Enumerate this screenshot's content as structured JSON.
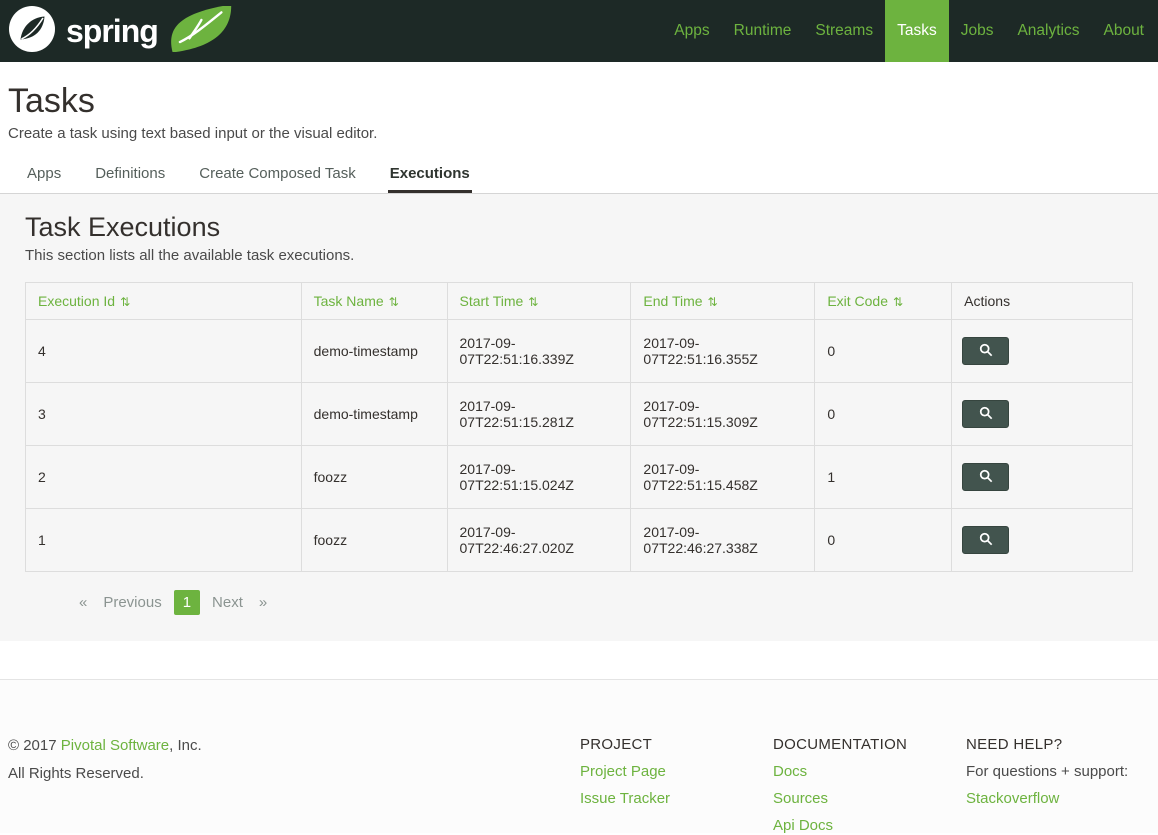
{
  "navbar": {
    "brand": "spring",
    "items": [
      {
        "label": "Apps",
        "active": false
      },
      {
        "label": "Runtime",
        "active": false
      },
      {
        "label": "Streams",
        "active": false
      },
      {
        "label": "Tasks",
        "active": true
      },
      {
        "label": "Jobs",
        "active": false
      },
      {
        "label": "Analytics",
        "active": false
      },
      {
        "label": "About",
        "active": false
      }
    ]
  },
  "page": {
    "title": "Tasks",
    "subtitle": "Create a task using text based input or the visual editor."
  },
  "tabs": [
    {
      "label": "Apps",
      "active": false
    },
    {
      "label": "Definitions",
      "active": false
    },
    {
      "label": "Create Composed Task",
      "active": false
    },
    {
      "label": "Executions",
      "active": true
    }
  ],
  "section": {
    "title": "Task Executions",
    "subtitle": "This section lists all the available task executions."
  },
  "table": {
    "columns": [
      {
        "label": "Execution Id",
        "sortable": true
      },
      {
        "label": "Task Name",
        "sortable": true
      },
      {
        "label": "Start Time",
        "sortable": true
      },
      {
        "label": "End Time",
        "sortable": true
      },
      {
        "label": "Exit Code",
        "sortable": true
      },
      {
        "label": "Actions",
        "sortable": false
      }
    ],
    "rows": [
      {
        "execution_id": "4",
        "task_name": "demo-timestamp",
        "start_time": "2017-09-07T22:51:16.339Z",
        "end_time": "2017-09-07T22:51:16.355Z",
        "exit_code": "0"
      },
      {
        "execution_id": "3",
        "task_name": "demo-timestamp",
        "start_time": "2017-09-07T22:51:15.281Z",
        "end_time": "2017-09-07T22:51:15.309Z",
        "exit_code": "0"
      },
      {
        "execution_id": "2",
        "task_name": "foozz",
        "start_time": "2017-09-07T22:51:15.024Z",
        "end_time": "2017-09-07T22:51:15.458Z",
        "exit_code": "1"
      },
      {
        "execution_id": "1",
        "task_name": "foozz",
        "start_time": "2017-09-07T22:46:27.020Z",
        "end_time": "2017-09-07T22:46:27.338Z",
        "exit_code": "0"
      }
    ]
  },
  "pagination": {
    "first_symbol": "«",
    "prev_label": "Previous",
    "current_page": "1",
    "next_label": "Next",
    "last_symbol": "»"
  },
  "footer": {
    "copyright_prefix": "© 2017",
    "company_link": "Pivotal Software",
    "copyright_suffix": ", Inc.",
    "rights": "All Rights Reserved.",
    "columns": [
      {
        "title": "PROJECT",
        "links": [
          "Project Page",
          "Issue Tracker"
        ]
      },
      {
        "title": "DOCUMENTATION",
        "links": [
          "Docs",
          "Sources",
          "Api Docs"
        ]
      },
      {
        "title": "NEED HELP?",
        "text": "For questions + support:",
        "links": [
          "Stackoverflow"
        ]
      }
    ]
  },
  "colors": {
    "accent": "#6db33f",
    "navbar_bg": "#1d2926",
    "panel_bg": "#f6f6f6",
    "heading": "#34302d",
    "table_border": "#dddddd",
    "detail_button_bg": "#42544e"
  }
}
